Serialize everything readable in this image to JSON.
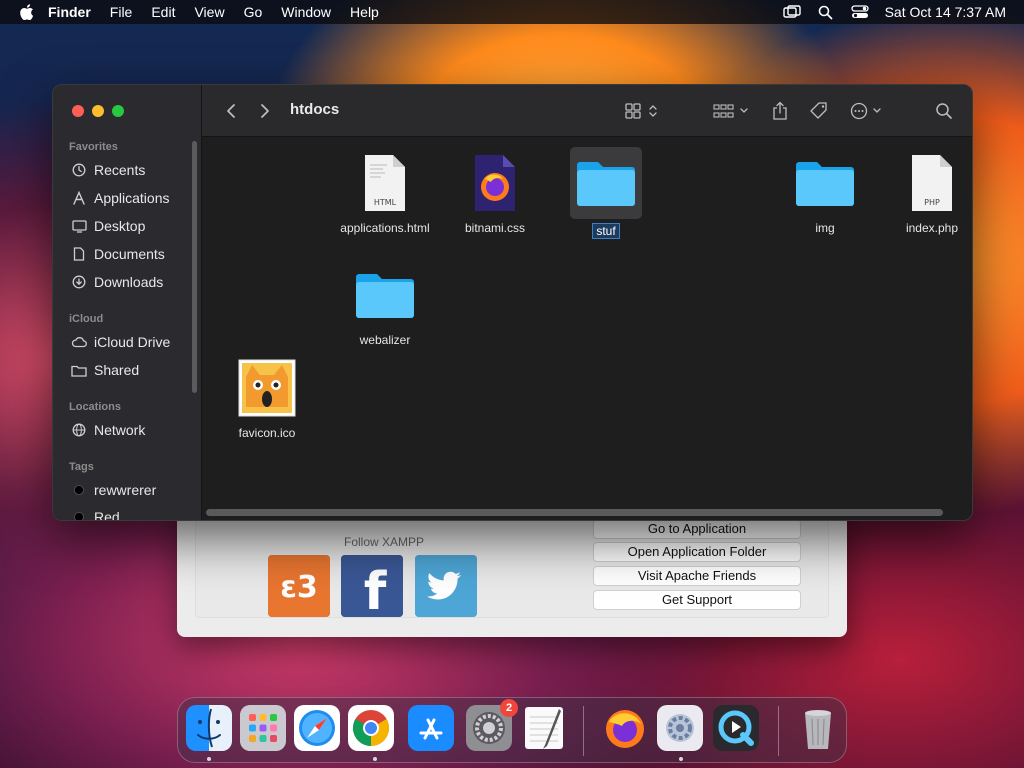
{
  "menubar": {
    "app_name": "Finder",
    "items": [
      "File",
      "Edit",
      "View",
      "Go",
      "Window",
      "Help"
    ],
    "clock": "Sat Oct 14  7:37 AM",
    "icons": [
      "apple-icon",
      "screen-mirroring-icon",
      "spotlight-search-icon",
      "control-center-icon"
    ]
  },
  "finder": {
    "title": "htdocs",
    "sidebar": {
      "sections": {
        "favorites": "Favorites",
        "icloud": "iCloud",
        "locations": "Locations",
        "tags": "Tags"
      },
      "favorites": [
        "Recents",
        "Applications",
        "Desktop",
        "Documents",
        "Downloads"
      ],
      "icloud": [
        "iCloud Drive",
        "Shared"
      ],
      "locations": [
        "Network"
      ],
      "tags": [
        "rewwrerer",
        "Red"
      ]
    },
    "files": [
      {
        "name": "applications.html",
        "kind": "html-file",
        "badge": "HTML"
      },
      {
        "name": "bitnami.css",
        "kind": "css-file"
      },
      {
        "name": "stuf",
        "kind": "folder",
        "selected": true
      },
      {
        "name": "img",
        "kind": "folder"
      },
      {
        "name": "index.php",
        "kind": "php-file",
        "badge": "PHP"
      },
      {
        "name": "webalizer",
        "kind": "folder"
      },
      {
        "name": "favicon.ico",
        "kind": "ico-file"
      }
    ]
  },
  "xampp": {
    "follow_label": "Follow  XAMPP",
    "buttons": [
      "Go to Application",
      "Open Application Folder",
      "Visit Apache Friends",
      "Get Support"
    ]
  },
  "dock": {
    "apps": [
      "Finder",
      "Launchpad",
      "Safari",
      "Google Chrome",
      "App Store",
      "System Preferences",
      "TextEdit",
      "Firefox",
      "XAMPP Manager",
      "QuickTime Player",
      "Trash"
    ],
    "badge_count": "2"
  },
  "colors": {
    "folder_blue": "#5ac8fa",
    "finder_bg": "#1e1e1e",
    "sidebar_bg": "#2b2a2e",
    "selection": "#3d7fc6"
  }
}
